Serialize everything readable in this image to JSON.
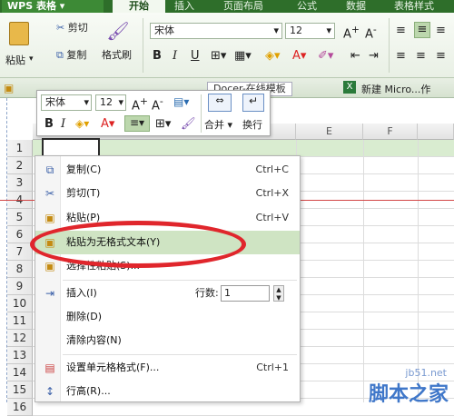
{
  "titlebar": {
    "app_name": "WPS 表格",
    "tabs": [
      "开始",
      "插入",
      "页面布局",
      "公式",
      "数据",
      "表格样式"
    ]
  },
  "ribbon": {
    "paste_label": "粘贴",
    "cut_label": "剪切",
    "copy_label": "复制",
    "format_painter_label": "格式刷",
    "font_name": "宋体",
    "font_size": "12"
  },
  "tabbar": {
    "doc_tab": "Docer-在线模板",
    "book_tab": "新建 Micro...作表.xlsx"
  },
  "mini_toolbar": {
    "font_name": "宋体",
    "font_size": "12",
    "merge_label": "合并",
    "wrap_label": "换行"
  },
  "columns": [
    "E",
    "F"
  ],
  "rows": [
    "1",
    "2",
    "3",
    "4",
    "5",
    "6",
    "7",
    "8",
    "9",
    "10",
    "11",
    "12",
    "13",
    "14",
    "15",
    "16"
  ],
  "context_menu": {
    "items": [
      {
        "label": "复制(C)",
        "shortcut": "Ctrl+C",
        "icon": "copy-icon"
      },
      {
        "label": "剪切(T)",
        "shortcut": "Ctrl+X",
        "icon": "scissors-icon"
      },
      {
        "label": "粘贴(P)",
        "shortcut": "Ctrl+V",
        "icon": "paste-icon"
      },
      {
        "label": "粘贴为无格式文本(Y)",
        "shortcut": "",
        "icon": "paste-text-icon"
      },
      {
        "label": "选择性粘贴(S)...",
        "shortcut": "",
        "icon": "paste-special-icon"
      },
      {
        "label": "插入(I)",
        "shortcut": "",
        "icon": "insert-icon"
      },
      {
        "label": "删除(D)",
        "shortcut": "",
        "icon": ""
      },
      {
        "label": "清除内容(N)",
        "shortcut": "",
        "icon": ""
      },
      {
        "label": "设置单元格格式(F)...",
        "shortcut": "Ctrl+1",
        "icon": "format-cells-icon"
      },
      {
        "label": "行高(R)...",
        "shortcut": "",
        "icon": "row-height-icon"
      }
    ],
    "rows_count_label": "行数:",
    "rows_count_value": "1"
  },
  "watermark": {
    "site": "jb51.net",
    "name": "脚本之家"
  }
}
